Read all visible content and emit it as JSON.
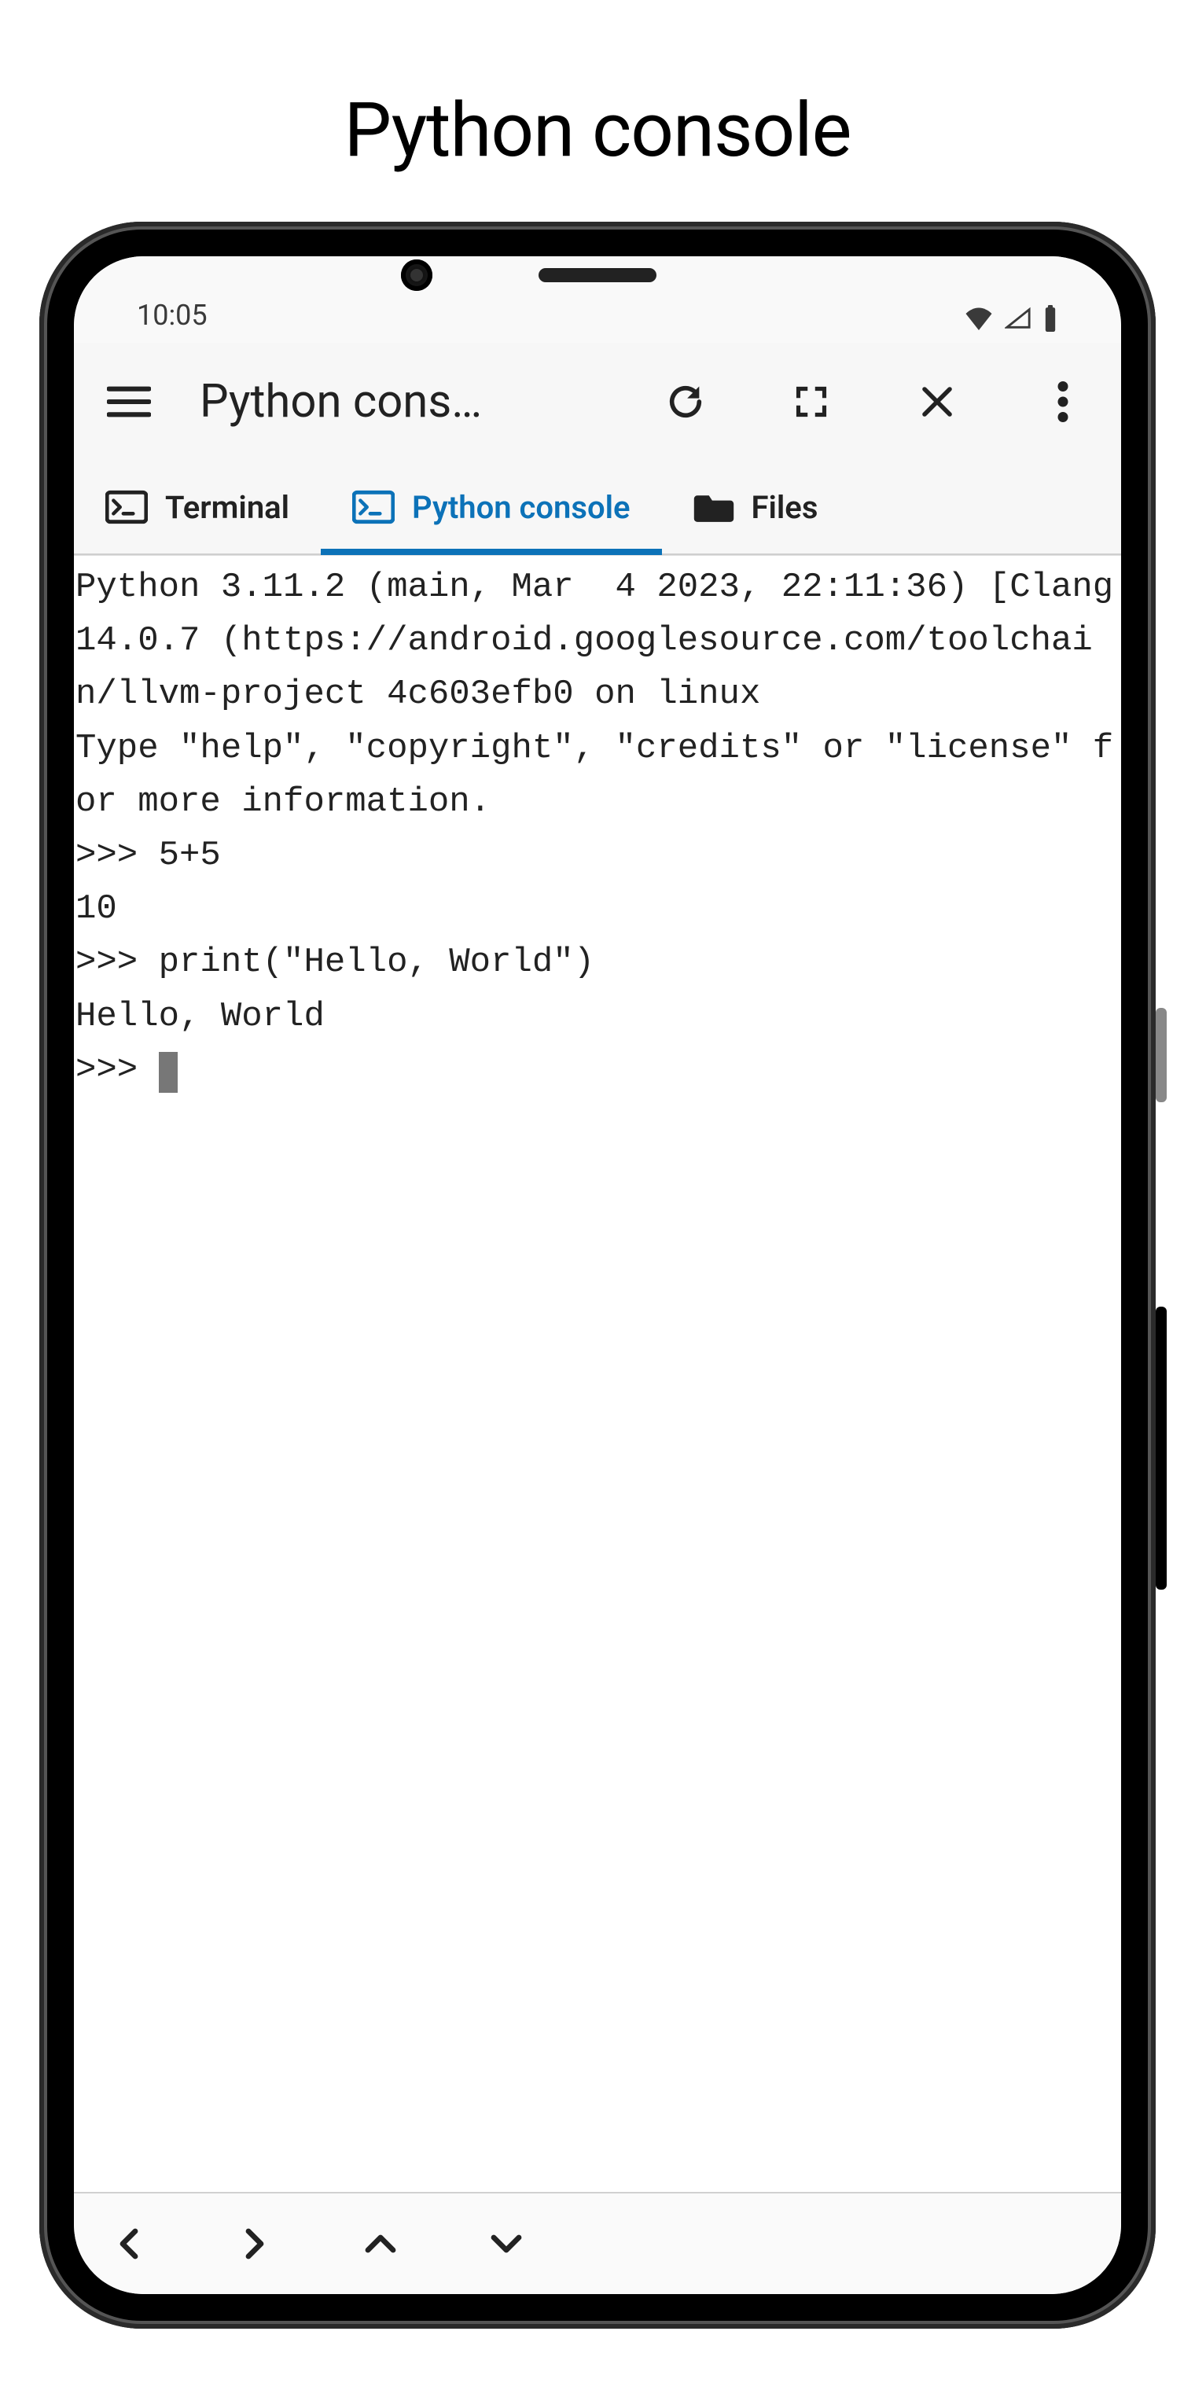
{
  "page": {
    "title": "Python console"
  },
  "statusbar": {
    "time": "10:05"
  },
  "appbar": {
    "title": "Python cons…"
  },
  "tabs": {
    "terminal": "Terminal",
    "python_console": "Python console",
    "files": "Files"
  },
  "console": {
    "text": "Python 3.11.2 (main, Mar  4 2023, 22:11:36) [Clang 14.0.7 (https://android.googlesource.com/toolchain/llvm-project 4c603efb0 on linux\nType \"help\", \"copyright\", \"credits\" or \"license\" for more information.\n>>> 5+5\n10\n>>> print(\"Hello, World\")\nHello, World\n>>> "
  }
}
